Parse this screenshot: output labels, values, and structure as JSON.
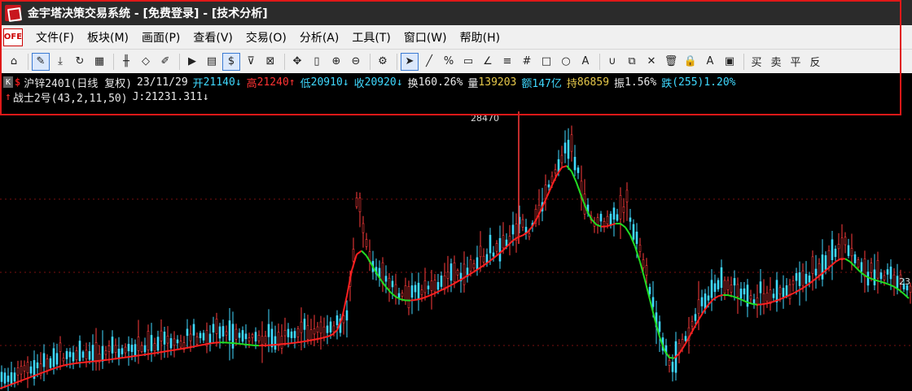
{
  "window": {
    "title": "金宇塔决策交易系统 - [免费登录] - [技术分析]"
  },
  "menu": {
    "logo": "OFE",
    "items": [
      "文件(F)",
      "板块(M)",
      "画面(P)",
      "查看(V)",
      "交易(O)",
      "分析(A)",
      "工具(T)",
      "窗口(W)",
      "帮助(H)"
    ]
  },
  "toolbar": {
    "icons": [
      "home-icon",
      "pen-icon",
      "download-icon",
      "refresh-icon",
      "grid-icon",
      "candles-icon",
      "diamond-icon",
      "edit-icon",
      "play-icon",
      "report-icon",
      "dollar-icon",
      "filter-icon",
      "split-icon",
      "move-icon",
      "bar-icon",
      "zoom-in-icon",
      "zoom-out-icon",
      "settings-icon",
      "pointer-icon",
      "line-icon",
      "percent-icon",
      "ruler-icon",
      "angle-icon",
      "level-icon",
      "hash-icon",
      "rect-icon",
      "circle-icon",
      "text-icon",
      "magnet-icon",
      "copy-icon",
      "delete-icon",
      "trash-icon",
      "lock-icon",
      "color-icon",
      "save-icon"
    ],
    "trade_buttons": [
      "买",
      "卖",
      "平",
      "反"
    ],
    "text_a": "A"
  },
  "info": {
    "k_badge": "K",
    "dollar": "$",
    "symbol": "沪锌2401(日线 复权)",
    "date": "23/11/29",
    "open_label": "开",
    "open": "21140",
    "open_arrow": "↓",
    "high_label": "高",
    "high": "21240",
    "high_arrow": "↑",
    "low_label": "低",
    "low": "20910",
    "low_arrow": "↓",
    "close_label": "收",
    "close": "20920",
    "close_arrow": "↓",
    "turnover_label": "换",
    "turnover": "160.26%",
    "volume_label": "量",
    "volume": "139203",
    "amount_label": "额",
    "amount": "147亿",
    "oi_label": "持",
    "oi": "86859",
    "amp_label": "振",
    "amp": "1.56%",
    "chg_label": "跌",
    "chg": "(255)1.20%"
  },
  "indicator": {
    "arrow": "↑",
    "name": "战士2号(43,2,11,50)",
    "j_label": "J:",
    "j_value": "21231.311",
    "j_arrow": "↓"
  },
  "chart_data": {
    "type": "candlestick",
    "peak_label": "28470",
    "right_edge_label": "23",
    "colors": {
      "up": "#ff3b3b",
      "down": "#3fd9ff",
      "ma_up": "#ff2020",
      "ma_down": "#22dd22",
      "grid": "#7a1010"
    }
  }
}
